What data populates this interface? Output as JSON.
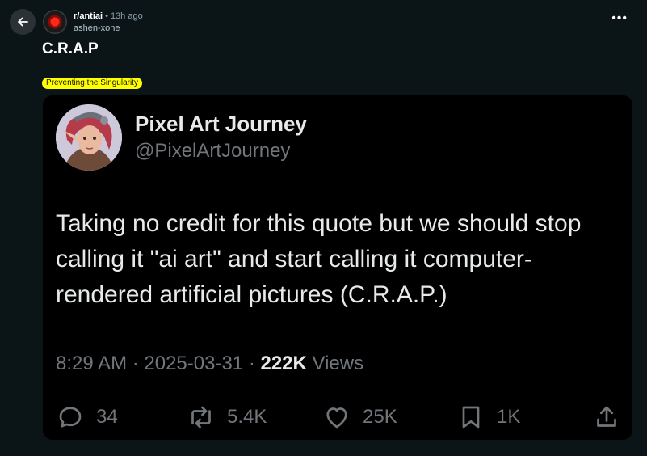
{
  "post": {
    "subreddit": "r/antiai",
    "separator": "•",
    "time": "13h ago",
    "author": "ashen-xone",
    "more_label": "•••",
    "title": "C.R.A.P",
    "flair": "Preventing the Singularity"
  },
  "tweet": {
    "name": "Pixel Art Journey",
    "handle": "@PixelArtJourney",
    "text": "Taking no credit for this quote but we should stop calling it \"ai art\" and start calling it computer-rendered artificial pictures (C.R.A.P.)",
    "time": "8:29 AM",
    "date": "2025-03-31",
    "meta_sep": " · ",
    "views_count": "222K",
    "views_label": " Views",
    "actions": {
      "replies": "34",
      "reposts": "5.4K",
      "likes": "25K",
      "bookmarks": "1K"
    }
  },
  "icons": {
    "back": "arrow-left-icon",
    "reply": "speech-bubble-icon",
    "repost": "repost-arrows-icon",
    "like": "heart-icon",
    "bookmark": "bookmark-icon",
    "share": "share-upload-icon"
  },
  "colors": {
    "page_bg": "#0b1416",
    "card_bg": "#000000",
    "flair_bg": "#ffff00",
    "muted_text": "#71767b",
    "primary_text": "#e7e9ea"
  }
}
